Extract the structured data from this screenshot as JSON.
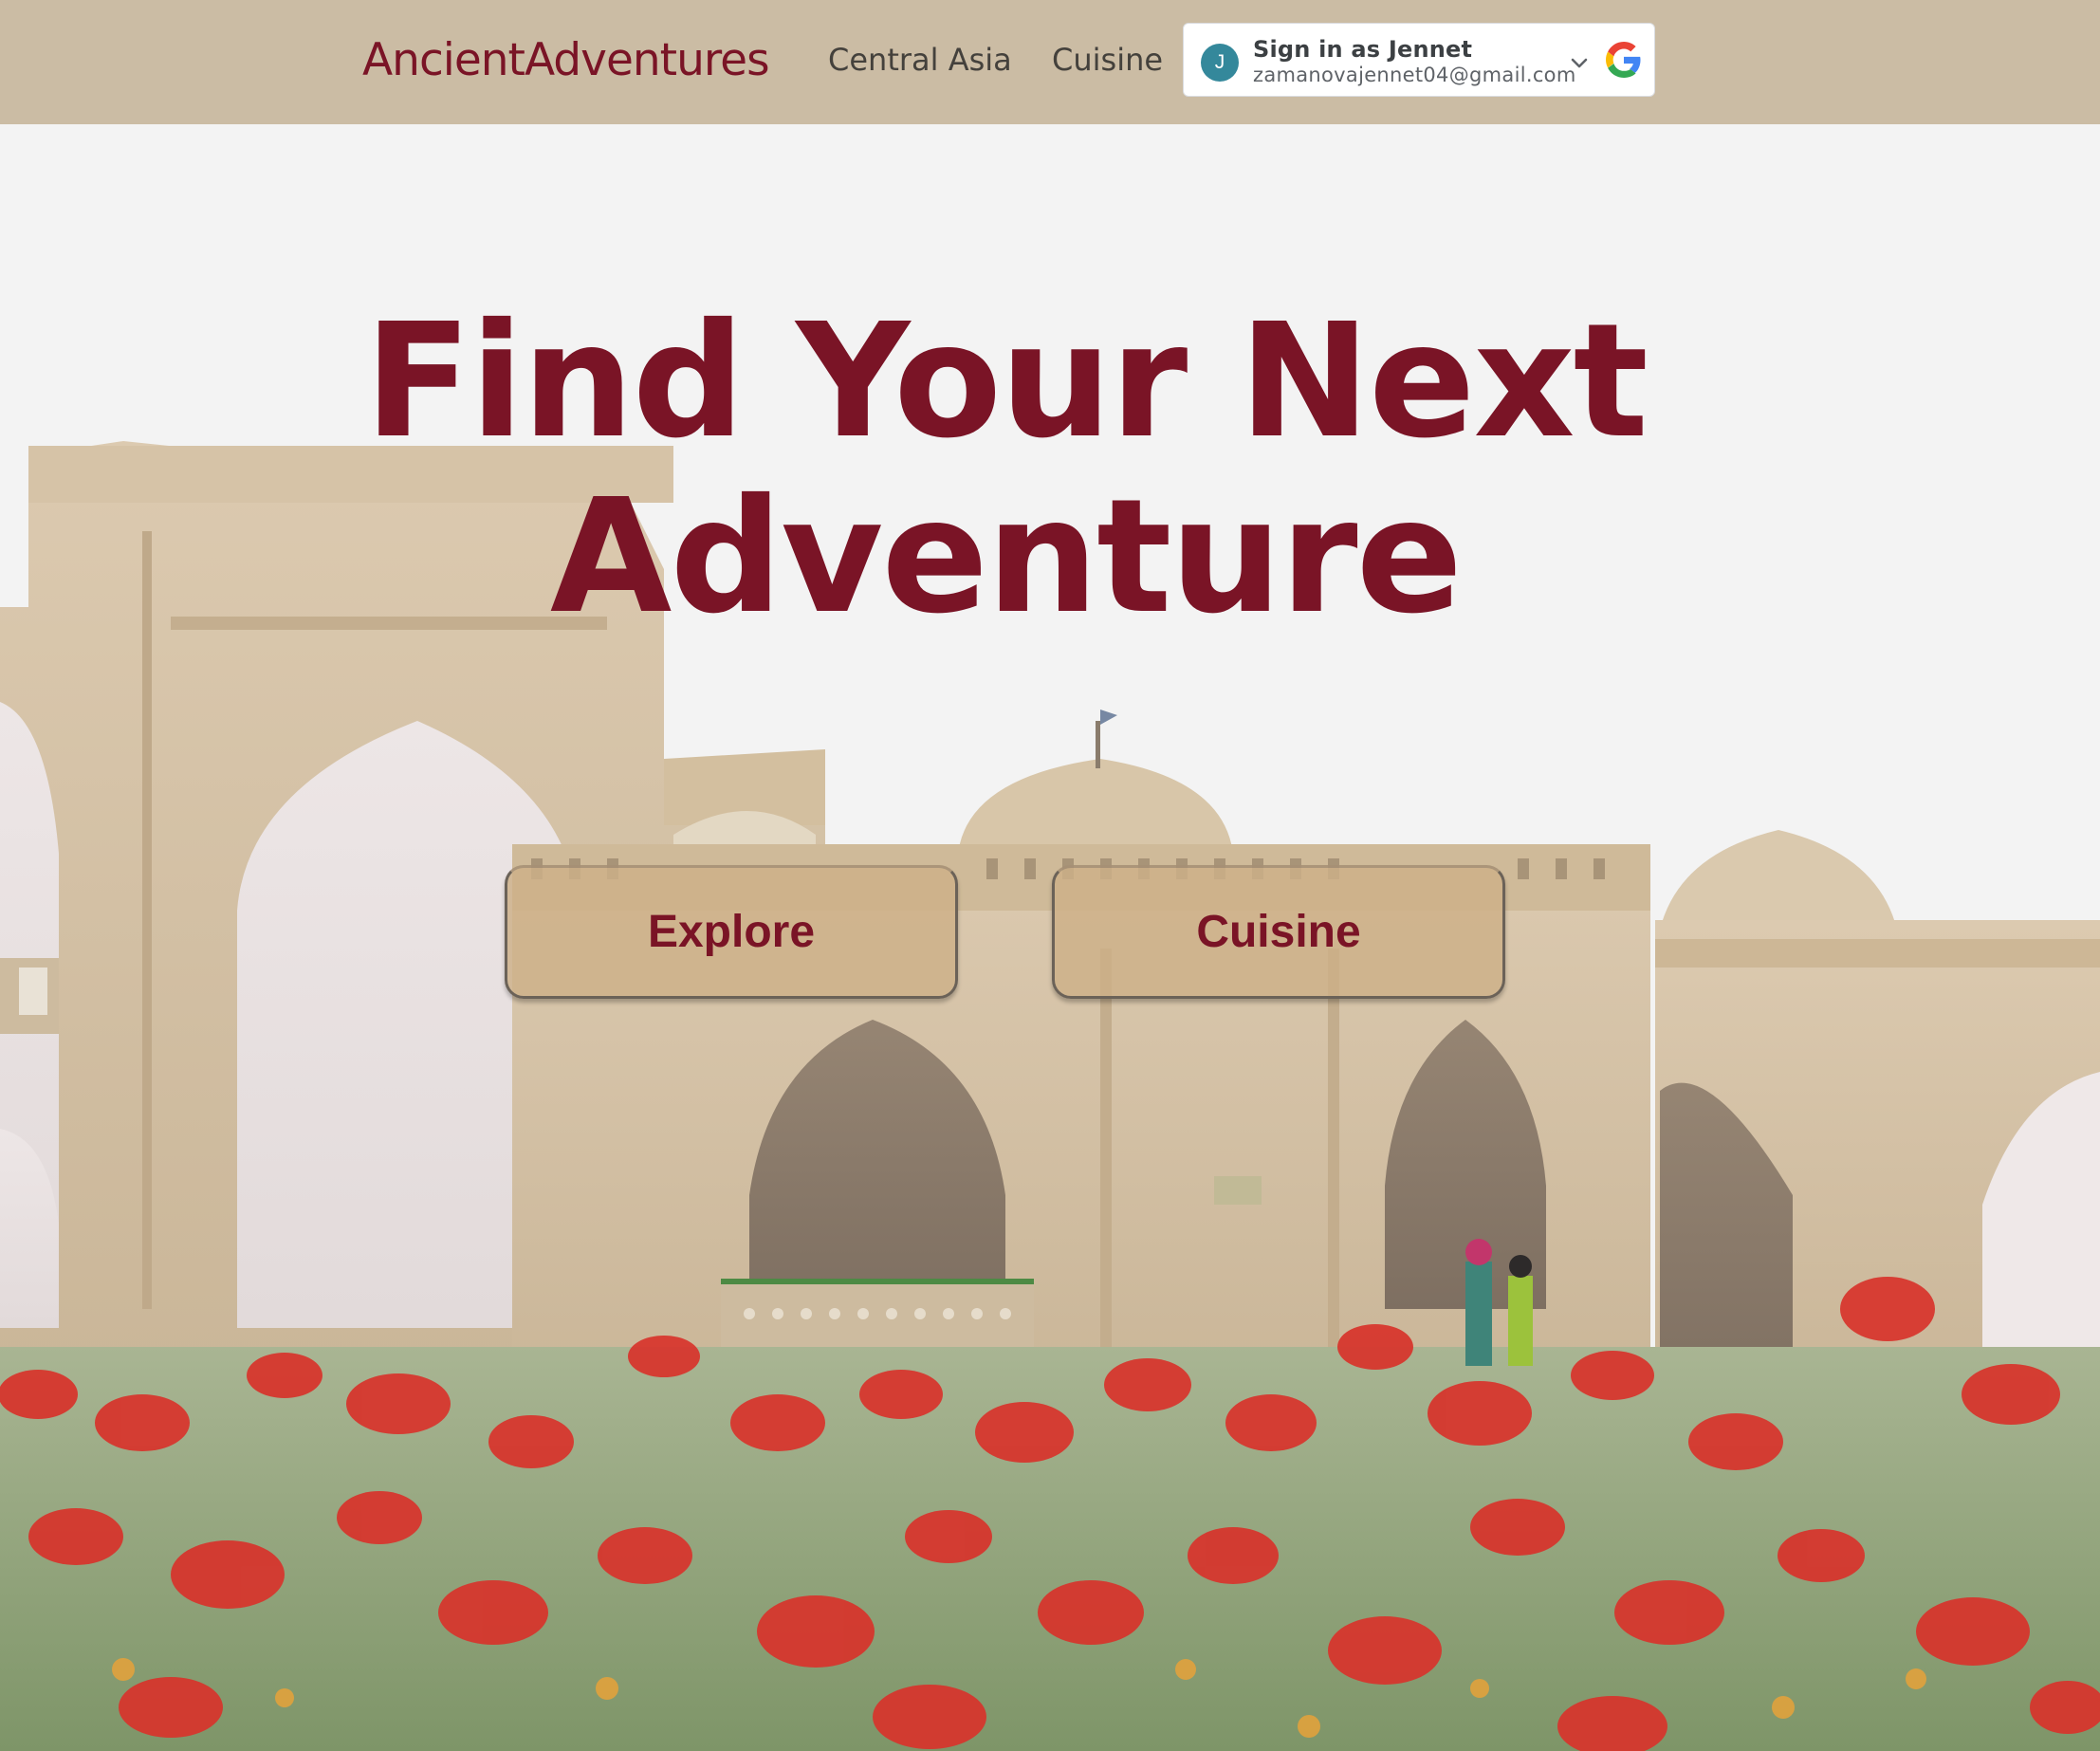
{
  "navbar": {
    "brand": "AncientAdventures",
    "links": [
      "Central Asia",
      "Cuisine"
    ]
  },
  "signin": {
    "avatar_initial": "J",
    "title": "Sign in as Jennet",
    "email": "zamanovajennet04@gmail.com",
    "icons": [
      "chevron-down-icon",
      "google-logo-icon"
    ]
  },
  "hero": {
    "headline_line1": "Find Your Next",
    "headline_line2": "Adventure",
    "buttons": [
      "Explore",
      "Cuisine"
    ]
  },
  "colors": {
    "brand": "#7a1426",
    "navbar_bg": "#cbbca4",
    "button_bg": "#cdb087",
    "page_bg": "#f3f3f3"
  }
}
